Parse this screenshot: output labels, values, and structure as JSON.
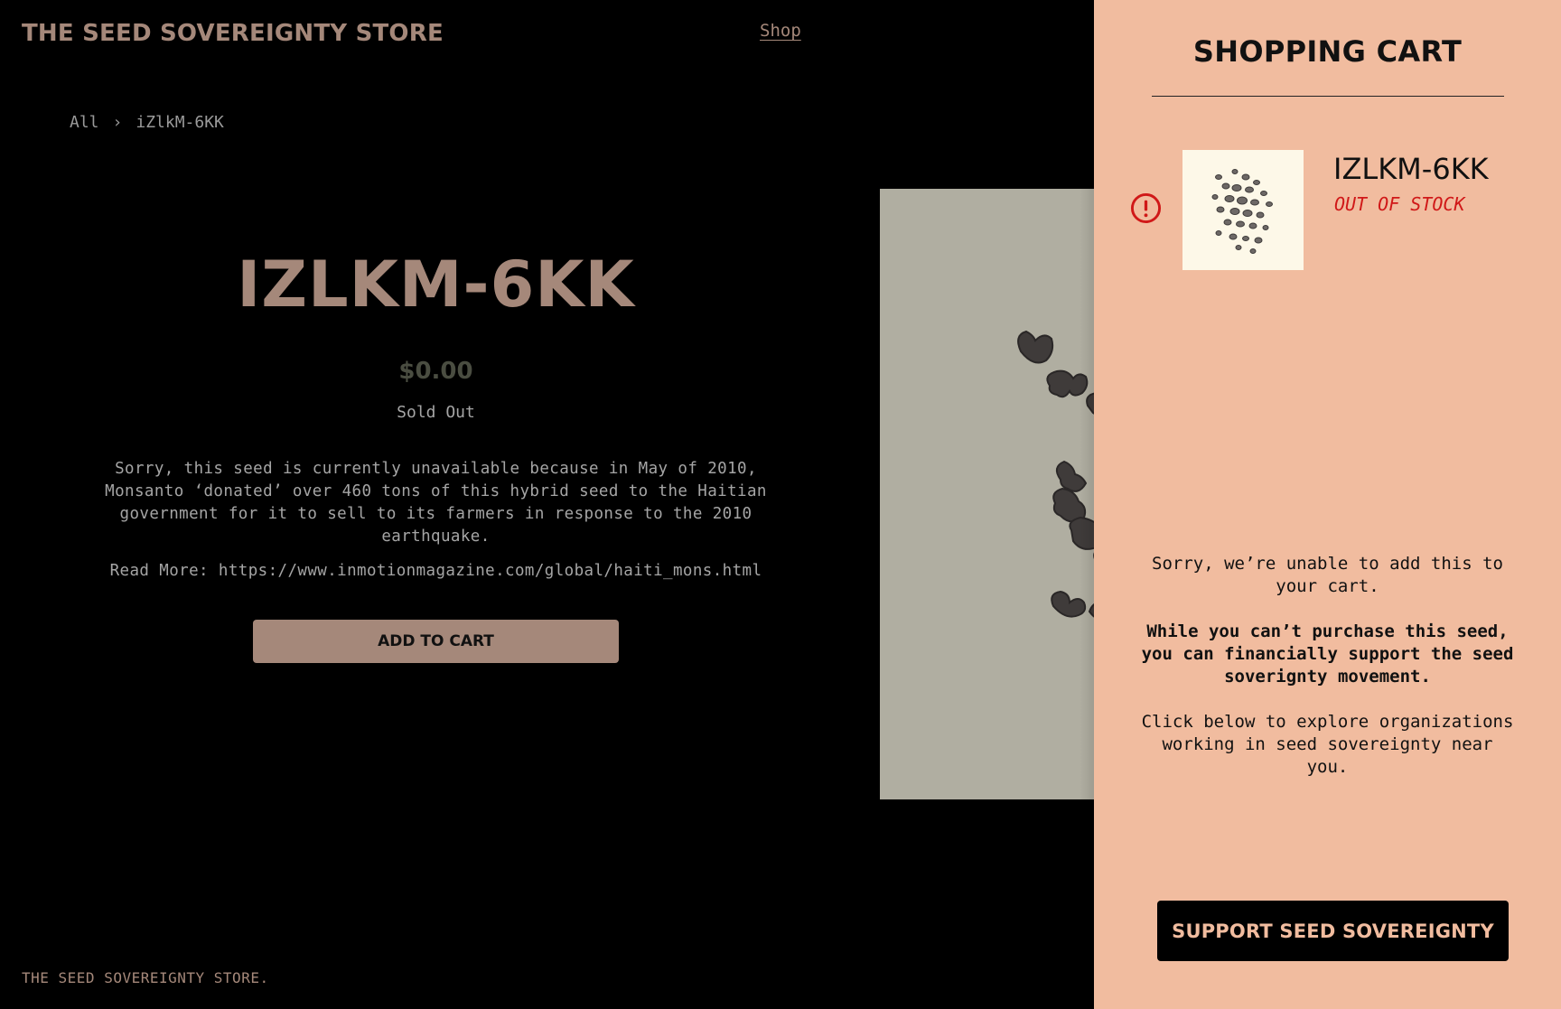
{
  "header": {
    "brand": "THE SEED SOVEREIGNTY STORE",
    "nav_shop": "Shop"
  },
  "breadcrumb": {
    "items": [
      "All",
      "iZlkM-6KK"
    ],
    "separator": "›"
  },
  "product": {
    "title": "IZLKM-6KK",
    "price": "$0.00",
    "availability": "Sold Out",
    "description": "Sorry, this seed is currently unavailable because in May of 2010, Monsanto ‘donated’ over 460 tons of this hybrid seed to the Haitian government for it to sell to its farmers in response to the 2010 earthquake.",
    "read_more": "Read More: https://www.inmotionmagazine.com/global/haiti_mons.html",
    "add_to_cart_label": "ADD TO CART"
  },
  "footer": {
    "text": "THE SEED SOVEREIGNTY STORE."
  },
  "cart": {
    "title": "SHOPPING CART",
    "items": [
      {
        "name": "IZLKM-6KK",
        "status": "OUT OF STOCK",
        "alert_icon": "exclamation-circle-icon"
      }
    ],
    "message_line1": "Sorry, we’re unable to add this to your cart.",
    "message_line2": "While you can’t purchase this seed, you can financially support the seed soverignty movement.",
    "message_line3": "Click below to explore organizations working in seed sovereignty near you.",
    "support_button_label": "SUPPORT SEED SOVEREIGNTY"
  },
  "colors": {
    "page_background": "#000000",
    "accent_tan": "#a5887a",
    "drawer_background": "#f1bc9f",
    "error_red": "#d01818",
    "image_background": "#b0aea1"
  }
}
